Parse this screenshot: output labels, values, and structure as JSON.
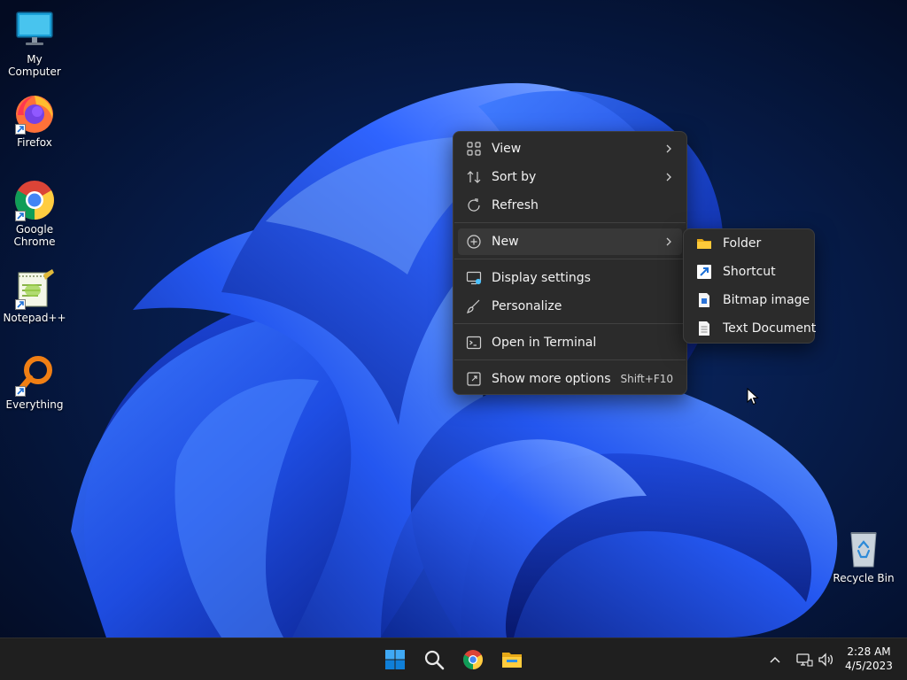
{
  "desktop": {
    "icons": [
      {
        "label": "My Computer",
        "icon": "monitor-icon"
      },
      {
        "label": "Firefox",
        "icon": "firefox-icon"
      },
      {
        "label": "Google Chrome",
        "icon": "chrome-icon"
      },
      {
        "label": "Notepad++",
        "icon": "notepadpp-icon"
      },
      {
        "label": "Everything",
        "icon": "everything-search-icon"
      }
    ],
    "recycle_bin": {
      "label": "Recycle Bin",
      "icon": "recycle-bin-icon"
    }
  },
  "context_menu": {
    "items": [
      {
        "label": "View",
        "icon": "view-grid-icon",
        "submenu": true
      },
      {
        "label": "Sort by",
        "icon": "sort-icon",
        "submenu": true
      },
      {
        "label": "Refresh",
        "icon": "refresh-icon"
      },
      {
        "label": "New",
        "icon": "new-plus-icon",
        "submenu": true,
        "highlighted": true
      },
      {
        "label": "Display settings",
        "icon": "display-settings-icon"
      },
      {
        "label": "Personalize",
        "icon": "personalize-brush-icon"
      },
      {
        "label": "Open in Terminal",
        "icon": "terminal-icon"
      },
      {
        "label": "Show more options",
        "icon": "more-options-icon",
        "shortcut": "Shift+F10"
      }
    ]
  },
  "new_submenu": {
    "items": [
      {
        "label": "Folder",
        "icon": "folder-icon"
      },
      {
        "label": "Shortcut",
        "icon": "shortcut-icon"
      },
      {
        "label": "Bitmap image",
        "icon": "bitmap-icon"
      },
      {
        "label": "Text Document",
        "icon": "text-document-icon"
      }
    ]
  },
  "taskbar": {
    "pinned": [
      {
        "name": "Start",
        "icon": "windows-start-icon"
      },
      {
        "name": "Search",
        "icon": "search-icon"
      },
      {
        "name": "Google Chrome",
        "icon": "chrome-icon"
      },
      {
        "name": "File Explorer",
        "icon": "file-explorer-icon"
      }
    ],
    "tray": {
      "time": "2:28 AM",
      "date": "4/5/2023"
    }
  },
  "colors": {
    "menu_background": "#2b2b2b",
    "menu_highlight": "#383838",
    "taskbar_background": "#1f1f1f",
    "accent": "#0078d4"
  }
}
